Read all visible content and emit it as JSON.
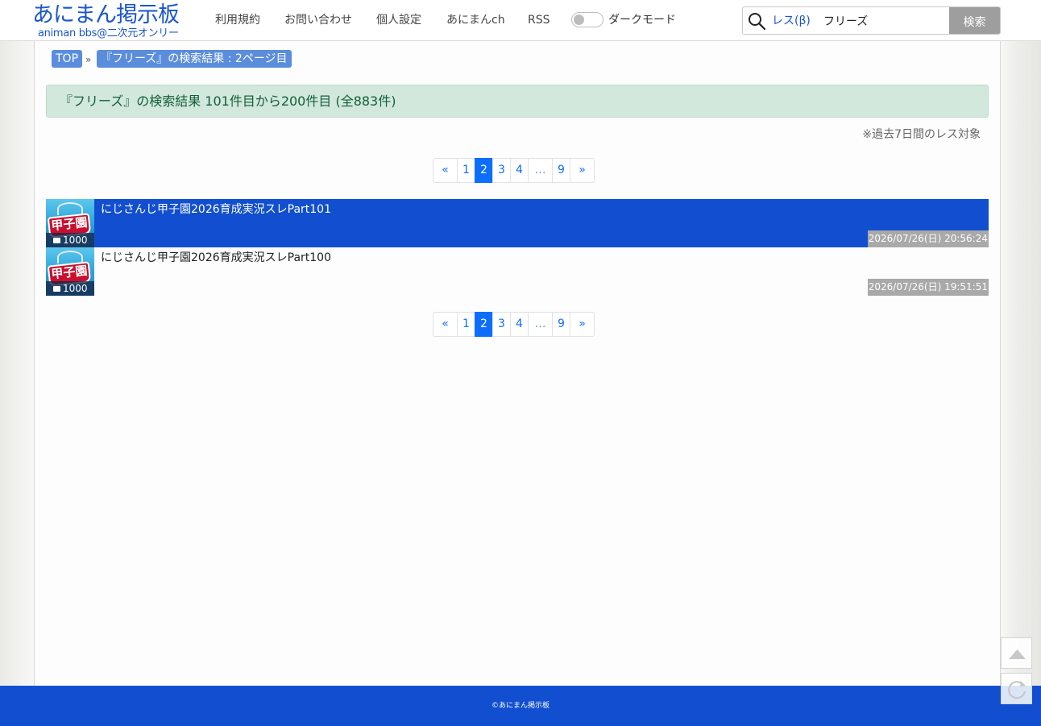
{
  "header": {
    "logo_main": "あにまん掲示板",
    "logo_sub": "animan bbs@二次元オンリー",
    "nav": [
      "利用規約",
      "お問い合わせ",
      "個人設定",
      "あにまんch",
      "RSS"
    ],
    "dark_mode_label": "ダークモード",
    "dark_mode_on": false,
    "search": {
      "type_label": "レス(β)",
      "value": "フリーズ",
      "button_label": "検索"
    }
  },
  "breadcrumb": {
    "top": "TOP",
    "separator": "»",
    "current": "『フリーズ』の検索結果 : 2ページ目"
  },
  "result_summary": "『フリーズ』の検索結果 101件目から200件目 (全883件)",
  "note": "※過去7日間のレス対象",
  "pagination": {
    "first": "«",
    "pages": [
      "1",
      "2",
      "3",
      "4",
      "…",
      "9"
    ],
    "next": "»",
    "active": "2"
  },
  "threads": [
    {
      "title": "にじさんじ甲子園2026育成実況スレPart101",
      "count": "1000",
      "date": "2026/07/26(日) 20:56:24",
      "thumb_text": "甲子園",
      "selected": true
    },
    {
      "title": "にじさんじ甲子園2026育成実況スレPart100",
      "count": "1000",
      "date": "2026/07/26(日) 19:51:51",
      "thumb_text": "甲子園",
      "selected": false
    }
  ],
  "footer": "©あにまん掲示板",
  "colors": {
    "brand_blue": "#114fd0",
    "pager_active": "#0d6efd",
    "summary_bg": "#d2e8dd",
    "summary_text": "#135e39"
  },
  "icons": [
    "search-icon",
    "comment-bubble-icon",
    "scroll-top-icon",
    "reload-icon"
  ]
}
